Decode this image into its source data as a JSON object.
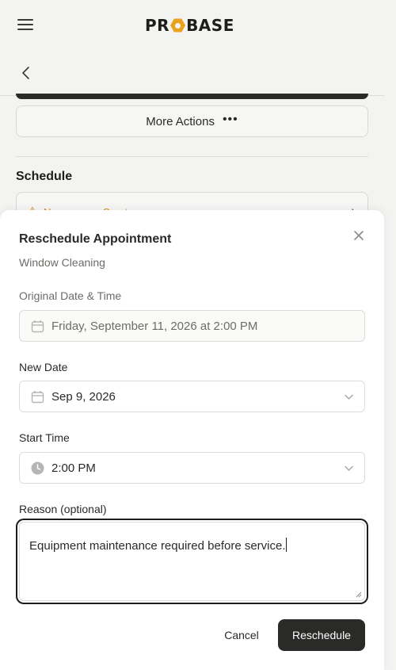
{
  "header": {
    "logo_text_left": "PR",
    "logo_text_right": "BASE",
    "logo_alt": "PROBASE"
  },
  "page": {
    "more_actions_label": "More Actions",
    "more_actions_dots": "•••",
    "schedule_heading": "Schedule",
    "warning_text": "No crews — Create one"
  },
  "modal": {
    "title": "Reschedule Appointment",
    "subtitle": "Window Cleaning",
    "original_label": "Original Date & Time",
    "original_value": "Friday, September 11, 2026 at 2:00 PM",
    "new_date_label": "New Date",
    "new_date_value": "Sep 9, 2026",
    "start_time_label": "Start Time",
    "start_time_value": "2:00 PM",
    "reason_label": "Reason (optional)",
    "reason_value": "Equipment maintenance required before service.",
    "cancel_label": "Cancel",
    "submit_label": "Reschedule"
  },
  "colors": {
    "accent": "#e8a21d",
    "warning": "#e08a1e",
    "primary_button": "#2a2a28"
  },
  "icons": [
    "menu-icon",
    "back-icon",
    "more-dots-icon",
    "warning-icon",
    "chevron-right-icon",
    "close-icon",
    "calendar-icon",
    "clock-icon",
    "chevron-down-icon"
  ]
}
